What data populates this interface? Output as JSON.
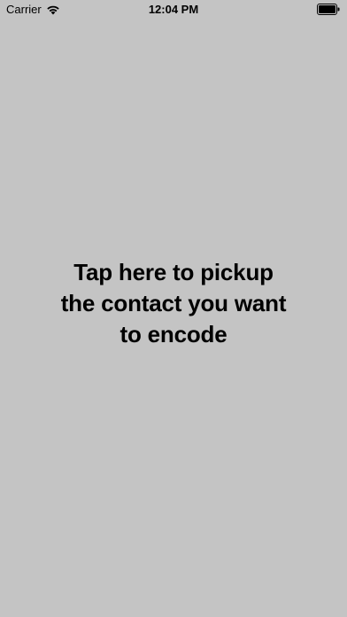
{
  "status_bar": {
    "carrier": "Carrier",
    "time": "12:04 PM",
    "wifi_icon": "wifi-icon",
    "battery_icon": "battery-full-icon"
  },
  "main": {
    "prompt": "Tap here to pickup\nthe contact you want\nto encode",
    "background_color": "#c4c4c4"
  }
}
